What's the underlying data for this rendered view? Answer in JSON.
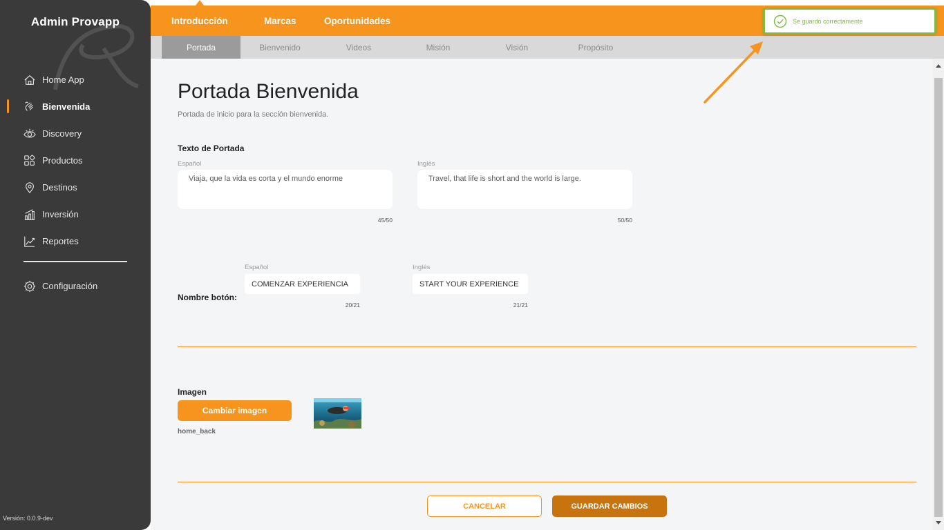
{
  "app": {
    "title": "Admin Provapp",
    "version": "Versión: 0.0.9-dev"
  },
  "colors": {
    "accent": "#f7941d",
    "sidebar": "#3a3a3a",
    "success": "#7dbb42",
    "save_button": "#c8740e"
  },
  "sidebar": {
    "items": [
      {
        "label": "Home App",
        "icon": "home-icon",
        "active": false
      },
      {
        "label": "Bienvenida",
        "icon": "waving-hand-icon",
        "active": true
      },
      {
        "label": "Discovery",
        "icon": "eye-icon",
        "active": false
      },
      {
        "label": "Productos",
        "icon": "grid-icon",
        "active": false
      },
      {
        "label": "Destinos",
        "icon": "location-pin-icon",
        "active": false
      },
      {
        "label": "Inversión",
        "icon": "bar-chart-icon",
        "active": false
      },
      {
        "label": "Reportes",
        "icon": "trend-chart-icon",
        "active": false
      }
    ],
    "config": {
      "label": "Configuración",
      "icon": "gear-icon"
    }
  },
  "topnav": {
    "tabs": [
      {
        "label": "Introducción",
        "active": true
      },
      {
        "label": "Marcas",
        "active": false
      },
      {
        "label": "Oportunidades",
        "active": false
      }
    ]
  },
  "subtabs": [
    {
      "label": "Portada",
      "active": true
    },
    {
      "label": "Bienvenido",
      "active": false
    },
    {
      "label": "Videos",
      "active": false
    },
    {
      "label": "Misión",
      "active": false
    },
    {
      "label": "Visión",
      "active": false
    },
    {
      "label": "Propósito",
      "active": false
    }
  ],
  "page": {
    "title": "Portada Bienvenida",
    "subtitle": "Portada de inicio para la sección bienvenida."
  },
  "cover_text": {
    "label": "Texto de Portada",
    "es": {
      "label": "Español",
      "value": "Viaja, que la vida es corta y el mundo enorme",
      "counter": "45/50"
    },
    "en": {
      "label": "Inglés",
      "value": "Travel, that life is short and the world is large.",
      "counter": "50/50"
    }
  },
  "button_name": {
    "label": "Nombre botón:",
    "es": {
      "label": "Español",
      "value": "COMENZAR EXPERIENCIA",
      "counter": "20/21"
    },
    "en": {
      "label": "Inglés",
      "value": "START YOUR EXPERIENCE",
      "counter": "21/21"
    }
  },
  "image": {
    "label": "Imagen",
    "change_button": "Cambiar imagen",
    "filename": "home_back"
  },
  "actions": {
    "cancel": "CANCELAR",
    "save": "GUARDAR CAMBIOS"
  },
  "toast": {
    "message": "Se guardó correctamente",
    "icon": "check-circle-icon"
  }
}
